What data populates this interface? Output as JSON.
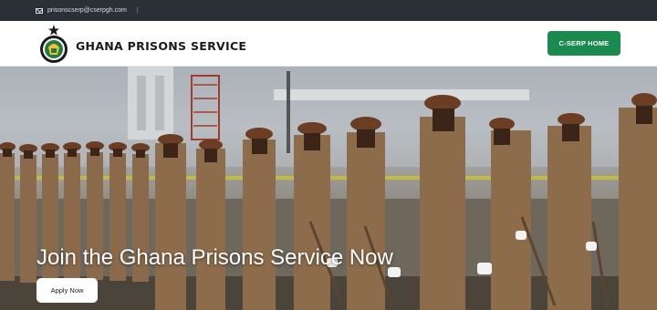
{
  "topbar": {
    "email": "prisonscserp@cserpgh.com",
    "separator": "|",
    "icon": "mail-icon"
  },
  "header": {
    "brand": "GHANA PRISONS SERVICE",
    "cta_label": "C-SERP HOME",
    "logo_icon": "ghana-prisons-crest-icon"
  },
  "hero": {
    "title": "Join the Ghana Prisons Service Now",
    "apply_label": "Apply Now"
  },
  "colors": {
    "topbar_bg": "#2b2f36",
    "accent_green": "#1a8a4e",
    "uniform_camo": "#8a6a4a",
    "beret": "#6b3d22"
  }
}
